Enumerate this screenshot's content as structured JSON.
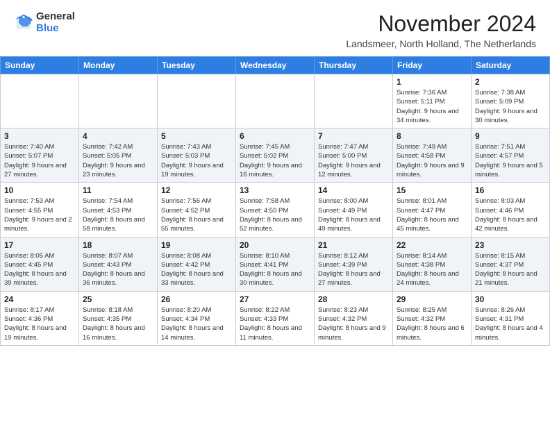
{
  "logo": {
    "general": "General",
    "blue": "Blue"
  },
  "title": "November 2024",
  "location": "Landsmeer, North Holland, The Netherlands",
  "weekdays": [
    "Sunday",
    "Monday",
    "Tuesday",
    "Wednesday",
    "Thursday",
    "Friday",
    "Saturday"
  ],
  "weeks": [
    [
      {
        "day": "",
        "info": ""
      },
      {
        "day": "",
        "info": ""
      },
      {
        "day": "",
        "info": ""
      },
      {
        "day": "",
        "info": ""
      },
      {
        "day": "",
        "info": ""
      },
      {
        "day": "1",
        "info": "Sunrise: 7:36 AM\nSunset: 5:11 PM\nDaylight: 9 hours and 34 minutes."
      },
      {
        "day": "2",
        "info": "Sunrise: 7:38 AM\nSunset: 5:09 PM\nDaylight: 9 hours and 30 minutes."
      }
    ],
    [
      {
        "day": "3",
        "info": "Sunrise: 7:40 AM\nSunset: 5:07 PM\nDaylight: 9 hours and 27 minutes."
      },
      {
        "day": "4",
        "info": "Sunrise: 7:42 AM\nSunset: 5:05 PM\nDaylight: 9 hours and 23 minutes."
      },
      {
        "day": "5",
        "info": "Sunrise: 7:43 AM\nSunset: 5:03 PM\nDaylight: 9 hours and 19 minutes."
      },
      {
        "day": "6",
        "info": "Sunrise: 7:45 AM\nSunset: 5:02 PM\nDaylight: 9 hours and 16 minutes."
      },
      {
        "day": "7",
        "info": "Sunrise: 7:47 AM\nSunset: 5:00 PM\nDaylight: 9 hours and 12 minutes."
      },
      {
        "day": "8",
        "info": "Sunrise: 7:49 AM\nSunset: 4:58 PM\nDaylight: 9 hours and 9 minutes."
      },
      {
        "day": "9",
        "info": "Sunrise: 7:51 AM\nSunset: 4:57 PM\nDaylight: 9 hours and 5 minutes."
      }
    ],
    [
      {
        "day": "10",
        "info": "Sunrise: 7:53 AM\nSunset: 4:55 PM\nDaylight: 9 hours and 2 minutes."
      },
      {
        "day": "11",
        "info": "Sunrise: 7:54 AM\nSunset: 4:53 PM\nDaylight: 8 hours and 58 minutes."
      },
      {
        "day": "12",
        "info": "Sunrise: 7:56 AM\nSunset: 4:52 PM\nDaylight: 8 hours and 55 minutes."
      },
      {
        "day": "13",
        "info": "Sunrise: 7:58 AM\nSunset: 4:50 PM\nDaylight: 8 hours and 52 minutes."
      },
      {
        "day": "14",
        "info": "Sunrise: 8:00 AM\nSunset: 4:49 PM\nDaylight: 8 hours and 49 minutes."
      },
      {
        "day": "15",
        "info": "Sunrise: 8:01 AM\nSunset: 4:47 PM\nDaylight: 8 hours and 45 minutes."
      },
      {
        "day": "16",
        "info": "Sunrise: 8:03 AM\nSunset: 4:46 PM\nDaylight: 8 hours and 42 minutes."
      }
    ],
    [
      {
        "day": "17",
        "info": "Sunrise: 8:05 AM\nSunset: 4:45 PM\nDaylight: 8 hours and 39 minutes."
      },
      {
        "day": "18",
        "info": "Sunrise: 8:07 AM\nSunset: 4:43 PM\nDaylight: 8 hours and 36 minutes."
      },
      {
        "day": "19",
        "info": "Sunrise: 8:08 AM\nSunset: 4:42 PM\nDaylight: 8 hours and 33 minutes."
      },
      {
        "day": "20",
        "info": "Sunrise: 8:10 AM\nSunset: 4:41 PM\nDaylight: 8 hours and 30 minutes."
      },
      {
        "day": "21",
        "info": "Sunrise: 8:12 AM\nSunset: 4:39 PM\nDaylight: 8 hours and 27 minutes."
      },
      {
        "day": "22",
        "info": "Sunrise: 8:14 AM\nSunset: 4:38 PM\nDaylight: 8 hours and 24 minutes."
      },
      {
        "day": "23",
        "info": "Sunrise: 8:15 AM\nSunset: 4:37 PM\nDaylight: 8 hours and 21 minutes."
      }
    ],
    [
      {
        "day": "24",
        "info": "Sunrise: 8:17 AM\nSunset: 4:36 PM\nDaylight: 8 hours and 19 minutes."
      },
      {
        "day": "25",
        "info": "Sunrise: 8:18 AM\nSunset: 4:35 PM\nDaylight: 8 hours and 16 minutes."
      },
      {
        "day": "26",
        "info": "Sunrise: 8:20 AM\nSunset: 4:34 PM\nDaylight: 8 hours and 14 minutes."
      },
      {
        "day": "27",
        "info": "Sunrise: 8:22 AM\nSunset: 4:33 PM\nDaylight: 8 hours and 11 minutes."
      },
      {
        "day": "28",
        "info": "Sunrise: 8:23 AM\nSunset: 4:32 PM\nDaylight: 8 hours and 9 minutes."
      },
      {
        "day": "29",
        "info": "Sunrise: 8:25 AM\nSunset: 4:32 PM\nDaylight: 8 hours and 6 minutes."
      },
      {
        "day": "30",
        "info": "Sunrise: 8:26 AM\nSunset: 4:31 PM\nDaylight: 8 hours and 4 minutes."
      }
    ]
  ]
}
